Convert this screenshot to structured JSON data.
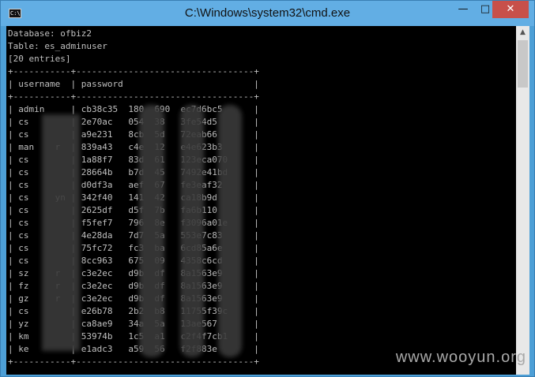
{
  "window": {
    "title": "C:\\Windows\\system32\\cmd.exe",
    "icon_label": "C:\\",
    "min_symbol": "—",
    "max_symbol": "□",
    "close_symbol": "✕"
  },
  "console": {
    "lines": [
      "Database: ofbiz2",
      "Table: es_adminuser",
      "[20 entries]",
      "+-----------+----------------------------------+",
      "| username  | password                         |",
      "+-----------+----------------------------------+",
      "| admin     | cb38c35  180  690  ec7d6bc5      |",
      "| cs        | 2e70ac   054  38   3fe54d5       |",
      "| cs        | a9e231   8cb  5d   72eab66       |",
      "| man    r  | 839a43   c4e  12   e4e623b3      |",
      "| cs        | 1a88f7   83d  61   123eca070     |",
      "| cs        | 28664b   b7d  45   7492e41bd     |",
      "| cs        | d0df3a   aef  67   fe3eaf32      |",
      "| cs     yn | 342f40   141  42   ca18b9d       |",
      "| cs        | 2625df   d5f  7b   fa6b110       |",
      "| cs        | f5fef7   796  8e   f3096a01e     |",
      "| cs        | 4e28da   7d7  5a   553e7c83      |",
      "| cs        | 75fc72   fc3  ba   6cd85a6e      |",
      "| cs        | 8cc963   675  09   4358c6cd      |",
      "| sz     r  | c3e2ec   d9b  df   8a1563e9      |",
      "| fz     r  | c3e2ec   d9b  df   8a1563e9      |",
      "| gz     r  | c3e2ec   d9b  df   8a1563e9      |",
      "| cs        | e26b78   2b2  b8   11755f39c     |",
      "| yz        | ca8ae9   34a  5a   13ae567       |",
      "| km        | 53974b   1c5  a1   c2f4f7cb1     |",
      "| ke        | e1adc3   a59  56   f2f883e       |",
      "+-----------+----------------------------------+"
    ]
  },
  "watermark": "www.wooyun.org"
}
